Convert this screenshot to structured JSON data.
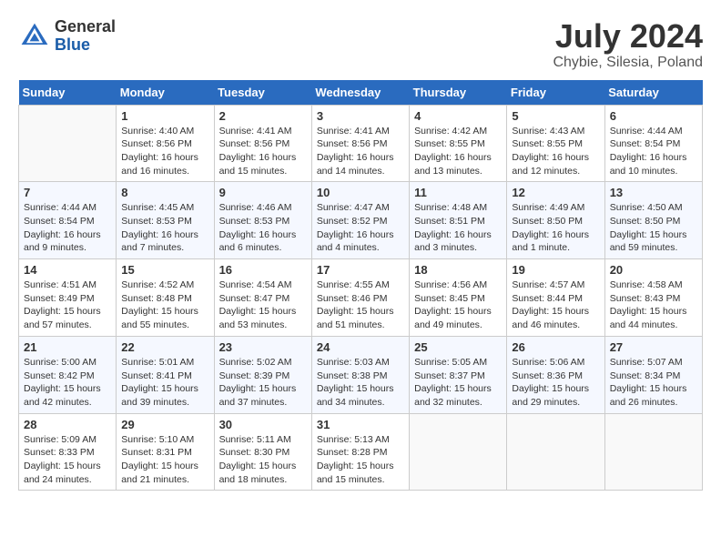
{
  "header": {
    "logo_general": "General",
    "logo_blue": "Blue",
    "month_year": "July 2024",
    "location": "Chybie, Silesia, Poland"
  },
  "days_of_week": [
    "Sunday",
    "Monday",
    "Tuesday",
    "Wednesday",
    "Thursday",
    "Friday",
    "Saturday"
  ],
  "weeks": [
    [
      {
        "day": "",
        "sunrise": "",
        "sunset": "",
        "daylight": ""
      },
      {
        "day": "1",
        "sunrise": "Sunrise: 4:40 AM",
        "sunset": "Sunset: 8:56 PM",
        "daylight": "Daylight: 16 hours and 16 minutes."
      },
      {
        "day": "2",
        "sunrise": "Sunrise: 4:41 AM",
        "sunset": "Sunset: 8:56 PM",
        "daylight": "Daylight: 16 hours and 15 minutes."
      },
      {
        "day": "3",
        "sunrise": "Sunrise: 4:41 AM",
        "sunset": "Sunset: 8:56 PM",
        "daylight": "Daylight: 16 hours and 14 minutes."
      },
      {
        "day": "4",
        "sunrise": "Sunrise: 4:42 AM",
        "sunset": "Sunset: 8:55 PM",
        "daylight": "Daylight: 16 hours and 13 minutes."
      },
      {
        "day": "5",
        "sunrise": "Sunrise: 4:43 AM",
        "sunset": "Sunset: 8:55 PM",
        "daylight": "Daylight: 16 hours and 12 minutes."
      },
      {
        "day": "6",
        "sunrise": "Sunrise: 4:44 AM",
        "sunset": "Sunset: 8:54 PM",
        "daylight": "Daylight: 16 hours and 10 minutes."
      }
    ],
    [
      {
        "day": "7",
        "sunrise": "Sunrise: 4:44 AM",
        "sunset": "Sunset: 8:54 PM",
        "daylight": "Daylight: 16 hours and 9 minutes."
      },
      {
        "day": "8",
        "sunrise": "Sunrise: 4:45 AM",
        "sunset": "Sunset: 8:53 PM",
        "daylight": "Daylight: 16 hours and 7 minutes."
      },
      {
        "day": "9",
        "sunrise": "Sunrise: 4:46 AM",
        "sunset": "Sunset: 8:53 PM",
        "daylight": "Daylight: 16 hours and 6 minutes."
      },
      {
        "day": "10",
        "sunrise": "Sunrise: 4:47 AM",
        "sunset": "Sunset: 8:52 PM",
        "daylight": "Daylight: 16 hours and 4 minutes."
      },
      {
        "day": "11",
        "sunrise": "Sunrise: 4:48 AM",
        "sunset": "Sunset: 8:51 PM",
        "daylight": "Daylight: 16 hours and 3 minutes."
      },
      {
        "day": "12",
        "sunrise": "Sunrise: 4:49 AM",
        "sunset": "Sunset: 8:50 PM",
        "daylight": "Daylight: 16 hours and 1 minute."
      },
      {
        "day": "13",
        "sunrise": "Sunrise: 4:50 AM",
        "sunset": "Sunset: 8:50 PM",
        "daylight": "Daylight: 15 hours and 59 minutes."
      }
    ],
    [
      {
        "day": "14",
        "sunrise": "Sunrise: 4:51 AM",
        "sunset": "Sunset: 8:49 PM",
        "daylight": "Daylight: 15 hours and 57 minutes."
      },
      {
        "day": "15",
        "sunrise": "Sunrise: 4:52 AM",
        "sunset": "Sunset: 8:48 PM",
        "daylight": "Daylight: 15 hours and 55 minutes."
      },
      {
        "day": "16",
        "sunrise": "Sunrise: 4:54 AM",
        "sunset": "Sunset: 8:47 PM",
        "daylight": "Daylight: 15 hours and 53 minutes."
      },
      {
        "day": "17",
        "sunrise": "Sunrise: 4:55 AM",
        "sunset": "Sunset: 8:46 PM",
        "daylight": "Daylight: 15 hours and 51 minutes."
      },
      {
        "day": "18",
        "sunrise": "Sunrise: 4:56 AM",
        "sunset": "Sunset: 8:45 PM",
        "daylight": "Daylight: 15 hours and 49 minutes."
      },
      {
        "day": "19",
        "sunrise": "Sunrise: 4:57 AM",
        "sunset": "Sunset: 8:44 PM",
        "daylight": "Daylight: 15 hours and 46 minutes."
      },
      {
        "day": "20",
        "sunrise": "Sunrise: 4:58 AM",
        "sunset": "Sunset: 8:43 PM",
        "daylight": "Daylight: 15 hours and 44 minutes."
      }
    ],
    [
      {
        "day": "21",
        "sunrise": "Sunrise: 5:00 AM",
        "sunset": "Sunset: 8:42 PM",
        "daylight": "Daylight: 15 hours and 42 minutes."
      },
      {
        "day": "22",
        "sunrise": "Sunrise: 5:01 AM",
        "sunset": "Sunset: 8:41 PM",
        "daylight": "Daylight: 15 hours and 39 minutes."
      },
      {
        "day": "23",
        "sunrise": "Sunrise: 5:02 AM",
        "sunset": "Sunset: 8:39 PM",
        "daylight": "Daylight: 15 hours and 37 minutes."
      },
      {
        "day": "24",
        "sunrise": "Sunrise: 5:03 AM",
        "sunset": "Sunset: 8:38 PM",
        "daylight": "Daylight: 15 hours and 34 minutes."
      },
      {
        "day": "25",
        "sunrise": "Sunrise: 5:05 AM",
        "sunset": "Sunset: 8:37 PM",
        "daylight": "Daylight: 15 hours and 32 minutes."
      },
      {
        "day": "26",
        "sunrise": "Sunrise: 5:06 AM",
        "sunset": "Sunset: 8:36 PM",
        "daylight": "Daylight: 15 hours and 29 minutes."
      },
      {
        "day": "27",
        "sunrise": "Sunrise: 5:07 AM",
        "sunset": "Sunset: 8:34 PM",
        "daylight": "Daylight: 15 hours and 26 minutes."
      }
    ],
    [
      {
        "day": "28",
        "sunrise": "Sunrise: 5:09 AM",
        "sunset": "Sunset: 8:33 PM",
        "daylight": "Daylight: 15 hours and 24 minutes."
      },
      {
        "day": "29",
        "sunrise": "Sunrise: 5:10 AM",
        "sunset": "Sunset: 8:31 PM",
        "daylight": "Daylight: 15 hours and 21 minutes."
      },
      {
        "day": "30",
        "sunrise": "Sunrise: 5:11 AM",
        "sunset": "Sunset: 8:30 PM",
        "daylight": "Daylight: 15 hours and 18 minutes."
      },
      {
        "day": "31",
        "sunrise": "Sunrise: 5:13 AM",
        "sunset": "Sunset: 8:28 PM",
        "daylight": "Daylight: 15 hours and 15 minutes."
      },
      {
        "day": "",
        "sunrise": "",
        "sunset": "",
        "daylight": ""
      },
      {
        "day": "",
        "sunrise": "",
        "sunset": "",
        "daylight": ""
      },
      {
        "day": "",
        "sunrise": "",
        "sunset": "",
        "daylight": ""
      }
    ]
  ]
}
